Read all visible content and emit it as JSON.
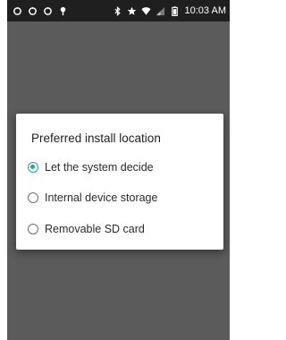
{
  "status_bar": {
    "left_icons": [
      "sync-icon",
      "sync-icon",
      "sync-icon",
      "location-pin-icon"
    ],
    "right_icons": [
      "bluetooth-icon",
      "star-icon",
      "wifi-icon",
      "signal-icon",
      "battery-icon"
    ],
    "time": "10:03 AM"
  },
  "dialog": {
    "title": "Preferred install location",
    "options": [
      {
        "label": "Let the system decide",
        "selected": true
      },
      {
        "label": "Internal device storage",
        "selected": false
      },
      {
        "label": "Removable SD card",
        "selected": false
      }
    ]
  },
  "colors": {
    "accent": "#26a69a",
    "scrim": "#5b5b5b",
    "status_bar": "#1f1f1f",
    "dialog_bg": "#ffffff"
  }
}
